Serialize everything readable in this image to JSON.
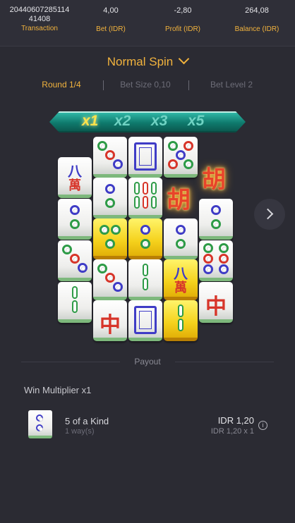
{
  "stats": {
    "transaction_value": "20440607285114\n41408",
    "transaction_value_line1": "20440607285114",
    "transaction_value_line2": "41408",
    "transaction_label": "Transaction",
    "bet_value": "4,00",
    "bet_label": "Bet (IDR)",
    "profit_value": "-2,80",
    "profit_label": "Profit (IDR)",
    "balance_value": "264,08",
    "balance_label": "Balance (IDR)"
  },
  "spin": {
    "type": "Normal Spin",
    "round": "Round 1/4",
    "bet_size": "Bet Size 0,10",
    "bet_level": "Bet Level 2"
  },
  "multipliers": [
    {
      "label": "x1",
      "active": true
    },
    {
      "label": "x2",
      "active": false
    },
    {
      "label": "x3",
      "active": false
    },
    {
      "label": "x5",
      "active": false
    }
  ],
  "reels": [
    [
      "eight-wan",
      "two-circles",
      "four-circles-b",
      "one-bamboo-stick"
    ],
    [
      "three-circles-diag",
      "two-circles",
      "two-circles-gold",
      "three-circles-diag",
      "red-dragon"
    ],
    [
      "white-dragon",
      "six-bamboo",
      "two-circles-gold",
      "two-bamboo",
      "white-dragon"
    ],
    [
      "five-circles",
      "wild",
      "two-circles",
      "eight-wan-gold",
      "two-bamboo-gold"
    ],
    [
      "wild",
      "two-circles",
      "six-circles",
      "red-dragon"
    ]
  ],
  "wild_glyph": "胡",
  "wan_glyph_top": "八",
  "wan_glyph_bottom": "萬",
  "red_dragon_glyph": "中",
  "payout": {
    "title": "Payout",
    "win_multiplier": "Win Multiplier x1",
    "combo_name": "5 of a Kind",
    "ways": "1 way(s)",
    "amount": "IDR 1,20",
    "calc": "IDR 1,20 x 1",
    "symbol": "two-circles"
  },
  "colors": {
    "accent": "#f2b33d",
    "background": "#2b2b33",
    "tile_green": "#2e9b47",
    "tile_blue": "#3f3cc6",
    "tile_red": "#d7352a",
    "gold_tile": "#f5d21d"
  }
}
